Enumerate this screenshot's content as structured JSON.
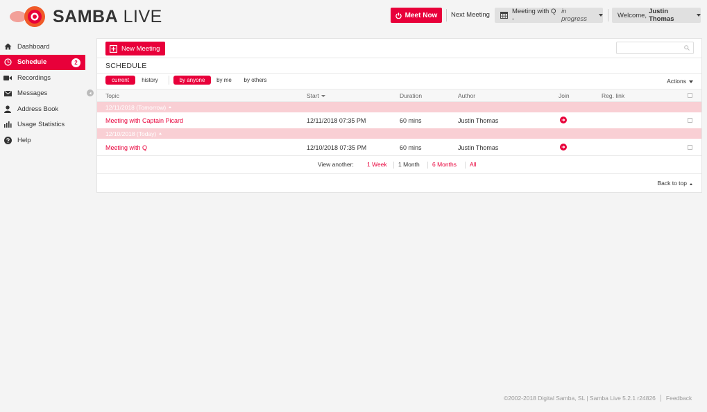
{
  "brand": {
    "bold": "SAMBA",
    "light": " LIVE",
    "accent": "#e8003a"
  },
  "topbar": {
    "meet_now": "Meet Now",
    "next_meeting_label": "Next Meeting",
    "next_meeting_name": "Meeting with Q - ",
    "next_meeting_status": "in progress",
    "welcome_prefix": "Welcome,",
    "welcome_user": "Justin Thomas"
  },
  "sidebar": {
    "items": [
      {
        "label": "Dashboard",
        "icon": "home-icon"
      },
      {
        "label": "Schedule",
        "icon": "clock-icon",
        "badge": "2",
        "active": true
      },
      {
        "label": "Recordings",
        "icon": "video-camera-icon"
      },
      {
        "label": "Messages",
        "icon": "envelope-icon"
      },
      {
        "label": "Address Book",
        "icon": "user-icon"
      },
      {
        "label": "Usage Statistics",
        "icon": "bar-chart-icon"
      },
      {
        "label": "Help",
        "icon": "help-icon"
      }
    ]
  },
  "panel": {
    "new_meeting": "New Meeting",
    "title": "SCHEDULE",
    "filters": {
      "current": "current",
      "history": "history",
      "by_anyone": "by anyone",
      "by_me": "by me",
      "by_others": "by others"
    },
    "actions": "Actions",
    "columns": {
      "topic": "Topic",
      "start": "Start",
      "duration": "Duration",
      "author": "Author",
      "join": "Join",
      "reg_link": "Reg. link"
    },
    "groups": [
      {
        "label": "12/11/2018 (Tomorrow)",
        "rows": [
          {
            "topic": "Meeting with Captain Picard",
            "start": "12/11/2018 07:35 PM",
            "duration": "60 mins",
            "author": "Justin Thomas"
          }
        ]
      },
      {
        "label": "12/10/2018 (Today)",
        "rows": [
          {
            "topic": "Meeting with Q",
            "start": "12/10/2018 07:35 PM",
            "duration": "60 mins",
            "author": "Justin Thomas"
          }
        ]
      }
    ],
    "view_another": {
      "label": "View another:",
      "week": "1 Week",
      "month": "1 Month",
      "six_months": "6 Months",
      "all": "All"
    },
    "back_to_top": "Back to top"
  },
  "footer": {
    "copyright": "©2002-2018 Digital Samba, SL | Samba Live 5.2.1 r24826",
    "feedback": "Feedback"
  }
}
